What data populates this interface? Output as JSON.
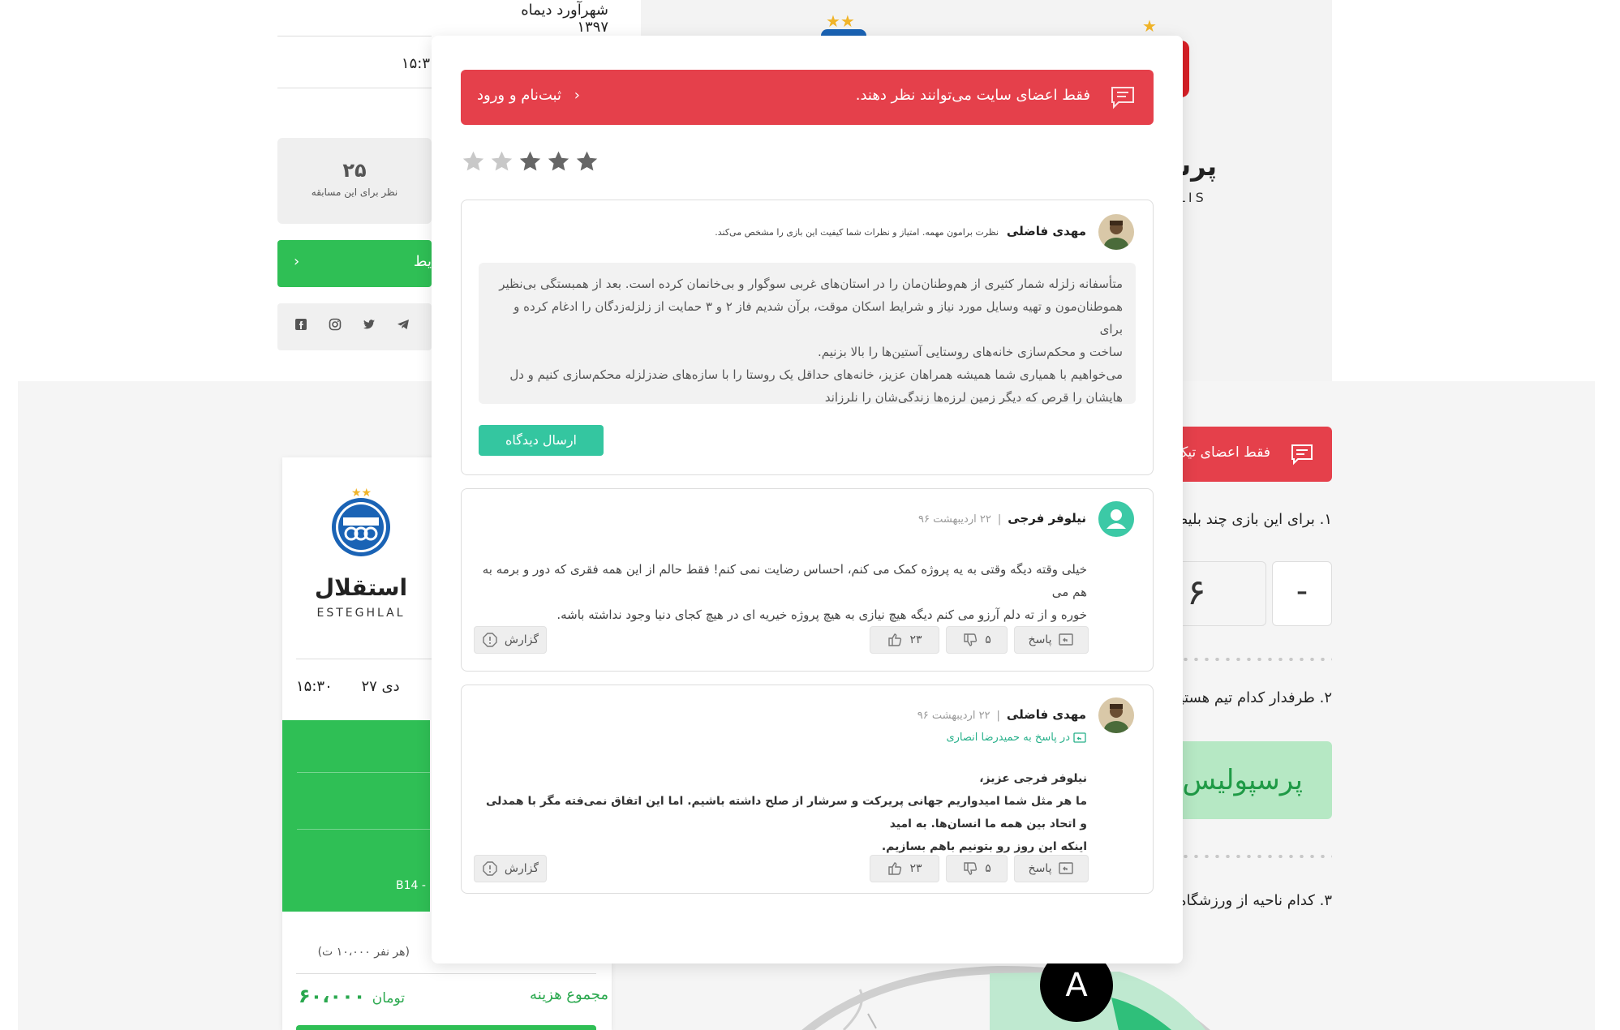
{
  "background": {
    "date_text": "شهرآورد دیماه ۱۳۹۷",
    "top_time": "۱۵:۳",
    "comment_count": "۲۵",
    "comment_count_label": "نظر برای این مسابقه",
    "green_button_label": "یط",
    "social_icons": [
      "facebook-icon",
      "instagram-icon",
      "twitter-icon",
      "telegram-icon"
    ],
    "left_team": {
      "name": "استقلال",
      "latin": "ESTEGHLAL"
    },
    "match_day": "۲۷ دی",
    "match_time": "۱۵:۳۰",
    "block_label": "B14 -",
    "per_person": "(هر نفر ۱۰،۰۰۰ ت)",
    "total_label": "مجموع هزینه",
    "total_value": "۶۰،۰۰۰",
    "total_currency": "تومان",
    "right_team": {
      "name": "پرس",
      "latin": "LIS"
    },
    "right_alert": "فقط اعضای تیک",
    "q1": "۱. برای این بازی چند بلیط",
    "stepper_value": "۶",
    "stepper_minus": "-",
    "q2": "۲. طرفدار کدام تیم هستید",
    "q2_answer": "پرسپولیس",
    "q3": "۳. کدام ناحیه از ورزشگاه؟",
    "stadium_badge": "A",
    "star_color": "#f0b429"
  },
  "modal": {
    "alert": {
      "message": "فقط اعضای سایت می‌توانند نظر دهند.",
      "link_label": "ثبت‌نام و ورود",
      "link_chevron": "‹",
      "icon": "comment-icon",
      "color": "#e5404b"
    },
    "rating": {
      "value": 3,
      "max": 5,
      "filled_color": "#666666",
      "empty_color": "#c8c8c8"
    },
    "composer": {
      "user_name": "مهدی فاضلی",
      "hint": "نظرت برامون مهمه. امتیاز و نظرات شما کیفیت این بازی را مشخص می‌کند.",
      "text_lines": [
        "متأسفانه زلزله شمار کثیری از هم‌وطنان‌مان را در استان‌های غربی سوگوار و بی‌خانمان کرده است. بعد از همبستگی بی‌نظیر",
        "هموطنان‌مون و تهیه وسایل مورد نیاز و شرایط اسکان موقت، برآن شدیم فاز ۲ و ۳ حمایت از زلزله‌زدگان را ادغام کرده و برای",
        "ساخت و محکم‌سازی خانه‌های روستایی آستین‌ها را بالا بزنیم.",
        "می‌خواهیم با همیاری شما همیشه همراهان عزیز، خانه‌های حداقل یک روستا را با سازه‌های ضدزلزله محکم‌سازی کنیم و دل",
        "هایشان را قرص که دیگر زمین لرزه‌ها زندگی‌شان را نلرزاند"
      ],
      "submit_label": "ارسال دیدگاه",
      "submit_color": "#34c6a0"
    },
    "comments": [
      {
        "user_name": "نیلوفر فرجی",
        "date": "۲۲ اردیبهشت ۹۶",
        "separator": "|",
        "avatar": "default-user-icon",
        "reply_to": "",
        "body_lines": [
          "خیلی وقته دیگه وقتی به یه پروژه کمک می کنم، احساس رضایت نمی کنم! فقط حالم از این همه فقری که دور و برمه به هم می",
          "خوره و از ته دلم آرزو می کنم دیگه هیچ نیازی به هیچ پروژه خیریه ای در هیچ کجای دنیا وجود نداشته باشه."
        ],
        "reply_label": "پاسخ",
        "dislikes": "۵",
        "likes": "۲۳",
        "report_label": "گزارش"
      },
      {
        "user_name": "مهدی فاضلی",
        "date": "۲۲ اردیبهشت ۹۶",
        "separator": "|",
        "avatar": "user-photo",
        "reply_to": "در پاسخ به حمیدرضا انصاری",
        "body_lines": [
          "نیلوفر فرجی عزیز،",
          "ما هر مثل شما امیدواریم جهانی پریرکت و سرشار از صلح داشته باشیم. اما این اتفاق نمی‌فته مگر با همدلی و اتحاد بین همه ما انسان‌ها. به امید",
          "اینکه این روز رو بتونیم باهم بسازیم."
        ],
        "reply_label": "پاسخ",
        "dislikes": "۵",
        "likes": "۲۳",
        "report_label": "گزارش"
      }
    ]
  }
}
